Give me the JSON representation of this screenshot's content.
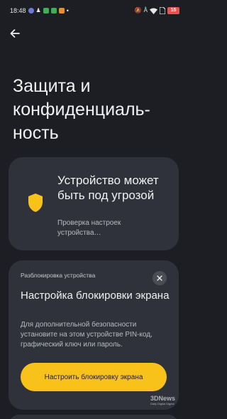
{
  "status_bar": {
    "time": "18:48",
    "dot": "•",
    "battery": "15"
  },
  "page": {
    "title": "Защита и конфиденциаль-ность"
  },
  "security_card": {
    "title": "Устройство может быть под угрозой",
    "subtitle": "Проверка настроек устройства…"
  },
  "lock_card": {
    "label": "Разблокировка устройства",
    "title": "Настройка блокировки экрана",
    "description": "Для дополнительной безопасности установите на этом устройстве PIN-код, графический ключ или пароль.",
    "button_label": "Настроить блокировку экрана"
  },
  "watermark": {
    "brand": "3DNews",
    "tagline": "Daily Digital Digest"
  },
  "colors": {
    "background": "#1c1e24",
    "card": "#2f323a",
    "accent": "#f8c21b",
    "battery": "#e8534f"
  }
}
